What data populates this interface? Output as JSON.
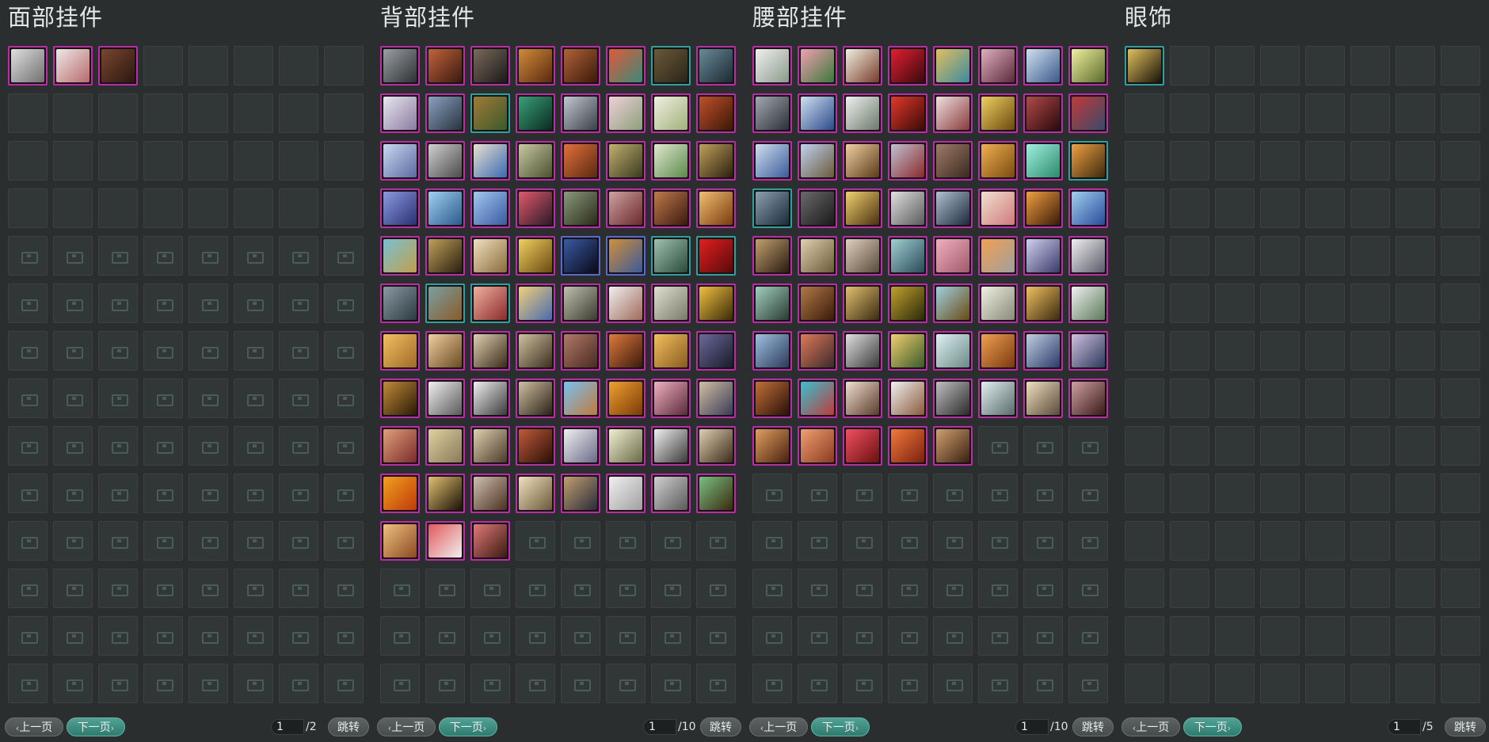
{
  "panels": [
    {
      "title": "面部挂件",
      "items": [
        "linear-gradient(135deg,#e0e0e0,#6f6f6f)",
        "linear-gradient(135deg,#f0e8e8,#b86a6a)",
        "linear-gradient(135deg,#7a4630,#2a1810)"
      ],
      "item_kinds": [
        "",
        "",
        ""
      ],
      "empty_plain": 29,
      "empty_chest": 80,
      "pager": {
        "prev": "上一页",
        "next": "下一页",
        "page": "1",
        "total": "/2",
        "jump": "跳转"
      }
    },
    {
      "title": "背部挂件",
      "items": [
        "linear-gradient(135deg,#9aa0a4,#2c3034)",
        "linear-gradient(135deg,#c0643a,#3a1a10)",
        "linear-gradient(135deg,#7a6a5a,#1a1a1a)",
        "linear-gradient(135deg,#d08a3a,#5a2a10)",
        "linear-gradient(135deg,#b0623a,#3a1a0a)",
        "linear-gradient(135deg,#e05a3a,#3a8a7a)",
        "linear-gradient(135deg,#6a5a3a,#2a2418)",
        "linear-gradient(135deg,#6a8a9a,#1a2a30)",
        "linear-gradient(135deg,#e8e8f0,#8a7aa0)",
        "linear-gradient(135deg,#8aa0c0,#2a3440)",
        "linear-gradient(135deg,#a07a3a,#3a5a2a)",
        "linear-gradient(135deg,#3aa07a,#0a2a20)",
        "linear-gradient(135deg,#c0c8d0,#3a4048)",
        "linear-gradient(135deg,#f0d0d8,#8aa07a)",
        "linear-gradient(135deg,#f0f0e0,#a0b07a)",
        "linear-gradient(135deg,#c0502a,#3a1808)",
        "linear-gradient(135deg,#c8d8f0,#5a6aa0)",
        "linear-gradient(135deg,#d0d0d0,#4a4a4a)",
        "linear-gradient(135deg,#e8e0d0,#3a6ab0)",
        "linear-gradient(135deg,#c8c8a0,#4a5030)",
        "linear-gradient(135deg,#e0703a,#5a2a10)",
        "linear-gradient(135deg,#c0b070,#3a3a20)",
        "linear-gradient(135deg,#e0e8d0,#5a8a4a)",
        "linear-gradient(135deg,#c0a05a,#2a2010)",
        "linear-gradient(135deg,#8a9ae0,#2a3070)",
        "linear-gradient(135deg,#a0d0f0,#2a5a8a)",
        "linear-gradient(135deg,#a0c8f0,#3a5aa0)",
        "linear-gradient(135deg,#e05a6a,#2a1a2a)",
        "linear-gradient(135deg,#8a9a7a,#2a2a1a)",
        "linear-gradient(135deg,#d0a0a0,#6a2a2a)",
        "linear-gradient(135deg,#c07a4a,#3a1a10)",
        "linear-gradient(135deg,#f0c070,#7a3a10)",
        "linear-gradient(135deg,#7ac0d0,#c0a04a)",
        "linear-gradient(135deg,#c0a05a,#2a2010)",
        "linear-gradient(135deg,#f0e0c0,#8a6a3a)",
        "linear-gradient(135deg,#f0d060,#6a4a10)",
        "linear-gradient(135deg,#3a5aa0,#0a0a1a)",
        "linear-gradient(135deg,#d0903a,#3a5a9a)",
        "linear-gradient(135deg,#a0c0b0,#2a4a3a)",
        "linear-gradient(135deg,#e02020,#5a0a0a)",
        "linear-gradient(135deg,#8a9aa0,#2a3a40)",
        "linear-gradient(135deg,#7aa0a0,#8a5a2a)",
        "linear-gradient(135deg,#f0b0a0,#8a2a2a)",
        "linear-gradient(135deg,#f0d07a,#4a6ab0)",
        "linear-gradient(135deg,#c0c0b0,#3a3a30)",
        "linear-gradient(135deg,#f0f0f0,#a06a5a)",
        "linear-gradient(135deg,#e0e0d0,#7a7a6a)",
        "linear-gradient(135deg,#f0c040,#3a2a08)",
        "linear-gradient(135deg,#f0c060,#a06a2a)",
        "linear-gradient(135deg,#f0d0a0,#6a4a20)",
        "linear-gradient(135deg,#e0d0b0,#3a2a1a)",
        "linear-gradient(135deg,#d0c0a0,#3a3020)",
        "linear-gradient(135deg,#b07a6a,#4a2a20)",
        "linear-gradient(135deg,#e07a3a,#3a1a10)",
        "linear-gradient(135deg,#f0c060,#8a5a20)",
        "linear-gradient(135deg,#6a6a9a,#1a1a2a)",
        "linear-gradient(135deg,#c08a3a,#2a1a08)",
        "linear-gradient(135deg,#f0f0f0,#5a5a5a)",
        "linear-gradient(135deg,#f0f0f0,#3a3a3a)",
        "linear-gradient(135deg,#d0c0a0,#2a2018)",
        "linear-gradient(135deg,#7ac0f0,#c07a3a)",
        "linear-gradient(135deg,#f0a030,#7a3a08)",
        "linear-gradient(135deg,#f0b0c0,#5a2a3a)",
        "linear-gradient(135deg,#d0c0a0,#3a3a5a)",
        "linear-gradient(135deg,#e0a07a,#7a2a2a)",
        "linear-gradient(135deg,#e0d0a0,#8a7a5a)",
        "linear-gradient(135deg,#e0d0b0,#4a3a2a)",
        "linear-gradient(135deg,#c05a3a,#2a1008)",
        "linear-gradient(135deg,#f0f0f0,#6a6a8a)",
        "linear-gradient(135deg,#f0f0d0,#6a6a4a)",
        "linear-gradient(135deg,#f0f0f0,#3a3a3a)",
        "linear-gradient(135deg,#e0d0b0,#3a2a1a)",
        "linear-gradient(135deg,#f0a020,#c03a08)",
        "linear-gradient(135deg,#e0c070,#1a1208)",
        "linear-gradient(135deg,#d0c0b0,#4a3020)",
        "linear-gradient(135deg,#f0e0c0,#6a5a3a)",
        "linear-gradient(135deg,#c0a070,#2a2a3a)",
        "linear-gradient(135deg,#f0f0f0,#a0a0a0)",
        "linear-gradient(135deg,#d0d0d0,#5a5a5a)",
        "linear-gradient(135deg,#7ac080,#3a2a10)",
        "linear-gradient(135deg,#f0c080,#8a4a20)",
        "linear-gradient(135deg,#e05a5a,#f0f0f0)",
        "linear-gradient(135deg,#e07a7a,#3a1a10)"
      ],
      "item_kinds": [
        "",
        "",
        "",
        "",
        "",
        "",
        "sp",
        "",
        "",
        "",
        "sp",
        "",
        "",
        "",
        "",
        "",
        "",
        "",
        "",
        "",
        "",
        "",
        "",
        "",
        "",
        "",
        "",
        "",
        "",
        "",
        "",
        "",
        "",
        "",
        "",
        "",
        "bl",
        "bl",
        "sp",
        "sp",
        "",
        "sp",
        "sp",
        "",
        "",
        "",
        "",
        "",
        "",
        "",
        "",
        "",
        "",
        "",
        "",
        ""
      ],
      "empty_plain": 0,
      "empty_chest": 29,
      "pager": {
        "prev": "上一页",
        "next": "下一页",
        "page": "1",
        "total": "/10",
        "jump": "跳转"
      }
    },
    {
      "title": "腰部挂件",
      "items": [
        "linear-gradient(135deg,#f0f0f0,#8a9a8a)",
        "linear-gradient(135deg,#f0a0b0,#3a7a3a)",
        "linear-gradient(135deg,#f0f0e0,#7a3a2a)",
        "linear-gradient(135deg,#e02030,#3a0a10)",
        "linear-gradient(135deg,#e0c060,#3a8aa0)",
        "linear-gradient(135deg,#e0b0c0,#5a2a3a)",
        "linear-gradient(135deg,#d0e0f0,#3a5a8a)",
        "linear-gradient(135deg,#f0f0a0,#5a6a2a)",
        "linear-gradient(135deg,#a0a8b0,#2a3038)",
        "linear-gradient(135deg,#d0e0f0,#2a4a8a)",
        "linear-gradient(135deg,#f0f0f0,#6a7a6a)",
        "linear-gradient(135deg,#e03a2a,#3a0a08)",
        "linear-gradient(135deg,#f0e0e0,#8a3a3a)",
        "linear-gradient(135deg,#f0d060,#6a4a10)",
        "linear-gradient(135deg,#b04a4a,#2a0a0a)",
        "linear-gradient(135deg,#c03a3a,#3a4a6a)",
        "linear-gradient(135deg,#d0e0f0,#3a5a9a)",
        "linear-gradient(135deg,#c0d0f0,#6a5a3a)",
        "linear-gradient(135deg,#f0d0a0,#5a3a1a)",
        "linear-gradient(135deg,#c0c0d0,#8a2a2a)",
        "linear-gradient(135deg,#a07a6a,#3a2a20)",
        "linear-gradient(135deg,#f0b050,#7a4a10)",
        "linear-gradient(135deg,#a0f0e0,#2a8a6a)",
        "linear-gradient(135deg,#f0a040,#3a2a10)",
        "linear-gradient(135deg,#8aa0b0,#1a2a3a)",
        "linear-gradient(135deg,#6a6a6a,#1a1a1a)",
        "linear-gradient(135deg,#f0d070,#4a3010)",
        "linear-gradient(135deg,#e0e0e0,#5a5a5a)",
        "linear-gradient(135deg,#b0c0d0,#1a2a3a)",
        "linear-gradient(135deg,#f0e0d0,#d07a7a)",
        "linear-gradient(135deg,#f0a040,#3a1a08)",
        "linear-gradient(135deg,#a0d0f0,#2a4a9a)",
        "linear-gradient(135deg,#c0a070,#2a1a10)",
        "linear-gradient(135deg,#e0d0b0,#6a5a3a)",
        "linear-gradient(135deg,#e0d0c0,#5a4a3a)",
        "linear-gradient(135deg,#a0d0d0,#2a4a5a)",
        "linear-gradient(135deg,#f0b0c0,#a05a6a)",
        "linear-gradient(135deg,#f0a050,#a0a0a0)",
        "linear-gradient(135deg,#d0d0f0,#3a3a6a)",
        "linear-gradient(135deg,#f0f0f0,#5a5a6a)",
        "linear-gradient(135deg,#a0d0c0,#2a3a30)",
        "linear-gradient(135deg,#b07a4a,#3a1a08)",
        "linear-gradient(135deg,#e0c070,#3a2a10)",
        "linear-gradient(135deg,#c0a030,#2a2a08)",
        "linear-gradient(135deg,#a0d0e0,#6a4a10)",
        "linear-gradient(135deg,#f0f0e0,#8a8a7a)",
        "linear-gradient(135deg,#f0c060,#3a2a10)",
        "linear-gradient(135deg,#f0f0f0,#5a7a5a)",
        "linear-gradient(135deg,#a0c0e0,#2a3a5a)",
        "linear-gradient(135deg,#e07a5a,#3a2a2a)",
        "linear-gradient(135deg,#e0e0e0,#3a3a3a)",
        "linear-gradient(135deg,#f0d070,#3a5a2a)",
        "linear-gradient(135deg,#e0f0f0,#6a8a8a)",
        "linear-gradient(135deg,#f0a050,#7a3a10)",
        "linear-gradient(135deg,#c0d0e0,#2a3a6a)",
        "linear-gradient(135deg,#d0c0e0,#2a3a5a)",
        "linear-gradient(135deg,#c0703a,#2a1008)",
        "linear-gradient(135deg,#3ac0d0,#c03a3a)",
        "linear-gradient(135deg,#f0e0d0,#5a3a2a)",
        "linear-gradient(135deg,#f0f0f0,#8a5a3a)",
        "linear-gradient(135deg,#c0c0c0,#2a2a2a)",
        "linear-gradient(135deg,#e0f0f0,#5a6a6a)",
        "linear-gradient(135deg,#f0e0c0,#5a4a3a)",
        "linear-gradient(135deg,#d0a0a0,#3a1a1a)",
        "linear-gradient(135deg,#e0a060,#4a2010)",
        "linear-gradient(135deg,#f0a070,#8a3a20)",
        "linear-gradient(135deg,#f05060,#6a1010)",
        "linear-gradient(135deg,#f07a3a,#7a2010)",
        "linear-gradient(135deg,#d0a070,#3a2010)"
      ],
      "item_kinds": [
        "",
        "",
        "",
        "",
        "",
        "",
        "",
        "",
        "",
        "",
        "",
        "",
        "",
        "",
        "",
        "",
        "",
        "",
        "",
        "",
        "",
        "",
        "",
        "sp",
        "sp",
        "",
        "",
        "",
        "",
        "",
        "",
        "",
        "",
        "",
        "",
        "",
        "",
        "",
        "",
        "",
        "",
        "",
        "",
        "",
        "",
        "",
        "",
        "",
        "",
        "",
        "",
        "",
        "",
        "",
        "",
        "",
        "",
        "",
        "",
        "",
        "",
        "",
        "",
        "",
        "",
        "",
        "",
        ""
      ],
      "empty_plain": 0,
      "empty_chest": 43,
      "pager": {
        "prev": "上一页",
        "next": "下一页",
        "page": "1",
        "total": "/10",
        "jump": "跳转"
      }
    },
    {
      "title": "眼饰",
      "items": [
        "linear-gradient(135deg,#e0c060,#1a1208)"
      ],
      "item_kinds": [
        "sp"
      ],
      "empty_plain": 111,
      "empty_chest": 0,
      "pager": {
        "prev": "上一页",
        "next": "下一页",
        "page": "1",
        "total": "/5",
        "jump": "跳转"
      }
    }
  ]
}
